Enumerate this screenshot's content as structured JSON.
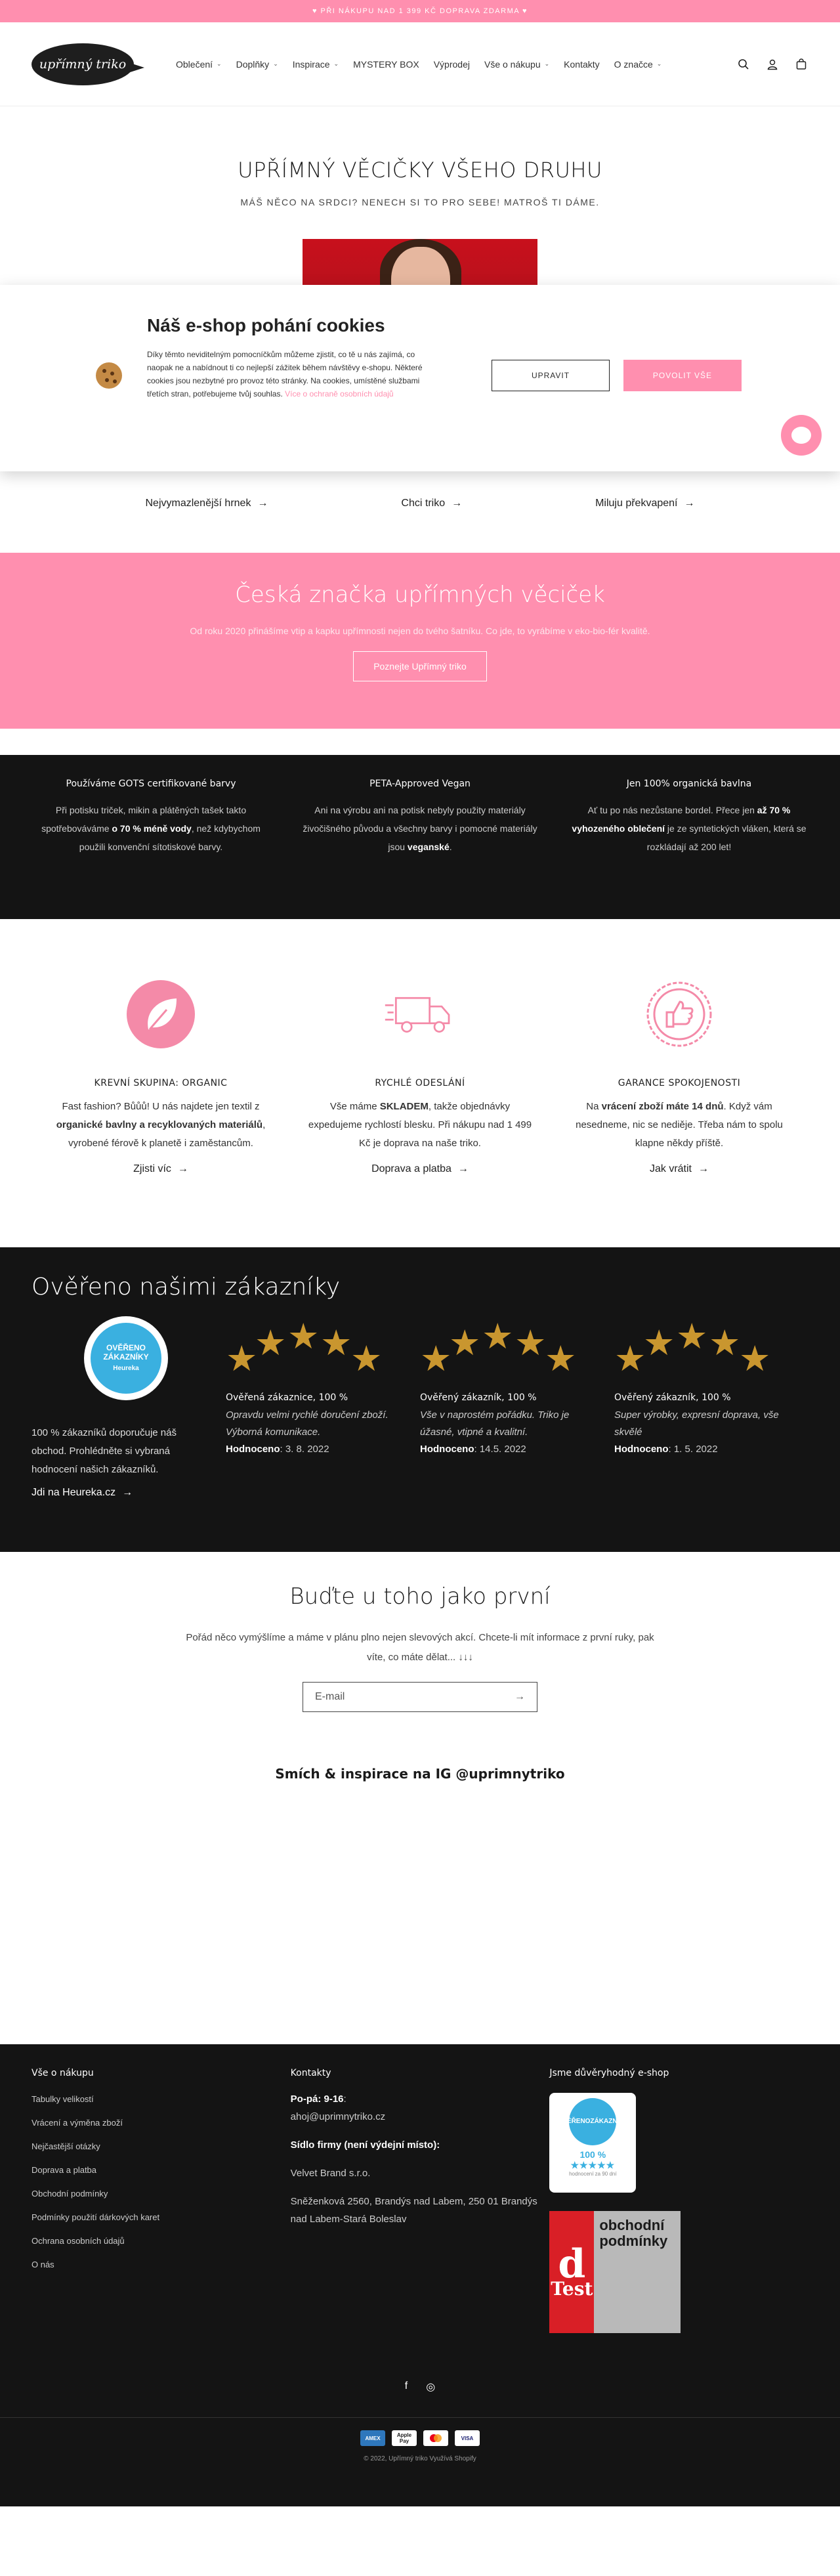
{
  "announcement": "♥ PŘI NÁKUPU NAD 1 399 KČ DOPRAVA ZDARMA ♥",
  "logo_text": "upřímný triko",
  "nav": [
    {
      "label": "Oblečení",
      "dropdown": true
    },
    {
      "label": "Doplňky",
      "dropdown": true
    },
    {
      "label": "Inspirace",
      "dropdown": true
    },
    {
      "label": "MYSTERY BOX",
      "dropdown": false
    },
    {
      "label": "Výprodej",
      "dropdown": false
    },
    {
      "label": "Vše o nákupu",
      "dropdown": true
    },
    {
      "label": "Kontakty",
      "dropdown": false
    },
    {
      "label": "O značce",
      "dropdown": true
    }
  ],
  "header_icons": [
    "search-icon",
    "account-icon",
    "cart-icon"
  ],
  "hero": {
    "title": "UPŘÍMNÝ VĚCIČKY VŠEHO DRUHU",
    "subtitle": "MÁŠ NĚCO NA SRDCI? NENECH SI TO PRO SEBE! MATROŠ TI DÁME."
  },
  "cookie": {
    "title": "Náš e-shop pohání cookies",
    "body": "Díky těmto neviditelným pomocníčkům můžeme zjistit, co tě u nás zajímá, co naopak ne a nabídnout ti co nejlepší zážitek během návštěvy e-shopu. Některé cookies jsou nezbytné pro provoz této stránky. Na cookies, umístěné službami třetích stran, potřebujeme tvůj souhlas.",
    "link": "Více o ochraně osobních údajů",
    "edit_button": "UPRAVIT",
    "allow_button": "POVOLIT VŠE"
  },
  "collection_links": [
    "Nejvymazlenější hrnek",
    "Chci triko",
    "Miluju překvapení"
  ],
  "brand": {
    "title": "Česká značka upřímných věciček",
    "text": "Od roku 2020 přinášíme vtip a kapku upřímnosti nejen do tvého šatníku. Co jde, to vyrábíme v eko-bio-fér kvalitě.",
    "button": "Poznejte Upřímný triko"
  },
  "facts": [
    {
      "title": "Používáme GOTS certifikované barvy",
      "pre": "Při potisku triček, mikin a plátěných tašek takto spotřebováváme ",
      "bold": "o 70 % méně vody",
      "post": ", než kdybychom použili konvenční sítotiskové barvy."
    },
    {
      "title": "PETA-Approved Vegan",
      "pre": "Ani na výrobu ani na potisk nebyly použity materiály živočišného původu a všechny barvy i pomocné materiály jsou ",
      "bold": "veganské",
      "post": "."
    },
    {
      "title": "Jen 100% organická bavlna",
      "pre": "Ať tu po nás nezůstane bordel. Přece jen ",
      "bold": "až 70 % vyhozeného oblečení",
      "post": " je ze syntetických vláken, která se rozkládají až 200 let!"
    }
  ],
  "features": [
    {
      "icon": "leaf-icon",
      "title": "KREVNÍ SKUPINA: ORGANIC",
      "pre": "Fast fashion? Bůůů! U nás najdete jen textil z ",
      "bold": "organické bavlny a recyklovaných materiálů",
      "post": ", vyrobené férově k planetě i zaměstancům.",
      "link": "Zjisti víc"
    },
    {
      "icon": "truck-icon",
      "title": "RYCHLÉ ODESLÁNÍ",
      "pre": "Vše máme ",
      "bold": "SKLADEM",
      "post": ", takže objednávky expedujeme rychlostí blesku. Při nákupu nad 1 499 Kč je doprava na naše triko.",
      "link": "Doprava a platba"
    },
    {
      "icon": "thumbs-up-icon",
      "title": "GARANCE SPOKOJENOSTI",
      "pre": "Na ",
      "bold": "vrácení zboží máte 14 dnů",
      "post": ". Když vám nesedneme, nic se nediěje. Třeba nám to spolu klapne někdy příště.",
      "link": "Jak vrátit"
    }
  ],
  "reviews": {
    "title": "Ověřeno našimi zákazníky",
    "heureka_badge": [
      "OVĚŘENO",
      "ZÁKAZNÍKY",
      "Heureka"
    ],
    "heureka_text": "100 % zákazníků doporučuje náš obchod. Prohlédněte si vybraná hodnocení našich zákazníků.",
    "heureka_link": "Jdi na Heureka.cz",
    "items": [
      {
        "title": "Ověřená zákaznice, 100 %",
        "text": "Opravdu velmi rychlé doručení zboží. Výborná komunikace.",
        "date_label": "Hodnoceno",
        "date": "3. 8. 2022"
      },
      {
        "title": "Ověřený zákazník, 100 %",
        "text": "Vše v naprostém pořádku. Triko je úžasné, vtipné a kvalitní.",
        "date_label": "Hodnoceno",
        "date": "14.5. 2022"
      },
      {
        "title": "Ověřený zákazník, 100 %",
        "text": "Super výrobky, expresní doprava, vše skvělé",
        "date_label": "Hodnoceno",
        "date": "1. 5. 2022"
      }
    ]
  },
  "newsletter": {
    "title": "Buďte u toho jako první",
    "text": "Pořád něco vymýšlíme a máme v plánu plno nejen slevových akcí. Chcete-li mít informace z první ruky, pak víte, co máte dělat... ↓↓↓",
    "placeholder": "E-mail"
  },
  "instagram_title": "Smích & inspirace na IG @uprimnytriko",
  "footer": {
    "col1_title": "Vše o nákupu",
    "col1_links": [
      "Tabulky velikostí",
      "Vrácení a výměna zboží",
      "Nejčastější otázky",
      "Doprava a platba",
      "Obchodní podmínky",
      "Podmínky použití dárkových karet",
      "Ochrana osobních údajů",
      "O nás"
    ],
    "col2_title": "Kontakty",
    "hours_label": "Po-pá: 9-16",
    "email": "ahoj@uprimnytriko.cz",
    "seat_label": "Sídlo firmy (není výdejní místo):",
    "company": "Velvet Brand s.r.o.",
    "address": "Sněženková 2560, Brandýs nad Labem, 250 01 Brandýs nad Labem-Stará Boleslav",
    "col3_title": "Jsme důvěryhodný e-shop",
    "trust_badge": {
      "line1": "OVĚŘENO",
      "line2": "ZÁKAZNÍKY",
      "percent": "100 %",
      "note": "hodnocení za 90 dní"
    },
    "dtest": {
      "letter": "d",
      "word": "Test",
      "title": "obchodní podmínky"
    }
  },
  "bottom": {
    "payments": [
      "AMEX",
      "Apple Pay",
      "Mastercard",
      "VISA"
    ],
    "copyright": "© 2022, Upřímný triko Využívá Shopify"
  }
}
